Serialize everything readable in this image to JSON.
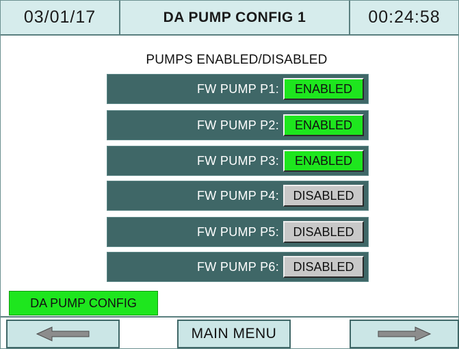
{
  "header": {
    "date": "03/01/17",
    "title": "DA PUMP CONFIG 1",
    "time": "00:24:58"
  },
  "section": {
    "title": "PUMPS ENABLED/DISABLED"
  },
  "pumps": [
    {
      "label": "FW PUMP  P1:",
      "state": "ENABLED"
    },
    {
      "label": "FW PUMP  P2:",
      "state": "ENABLED"
    },
    {
      "label": "FW PUMP  P3:",
      "state": "ENABLED"
    },
    {
      "label": "FW PUMP  P4:",
      "state": "DISABLED"
    },
    {
      "label": "FW PUMP  P5:",
      "state": "DISABLED"
    },
    {
      "label": "FW PUMP  P6:",
      "state": "DISABLED"
    }
  ],
  "config_tab": {
    "label": "DA PUMP CONFIG"
  },
  "footer": {
    "back_icon": "left-arrow-icon",
    "main_menu_label": "MAIN MENU",
    "forward_icon": "right-arrow-icon"
  },
  "colors": {
    "header_bg": "#d6ecec",
    "row_bg": "#3f6767",
    "enabled": "#1ee61e",
    "disabled": "#c8c8c8",
    "nav_button_bg": "#cbe6e6"
  }
}
